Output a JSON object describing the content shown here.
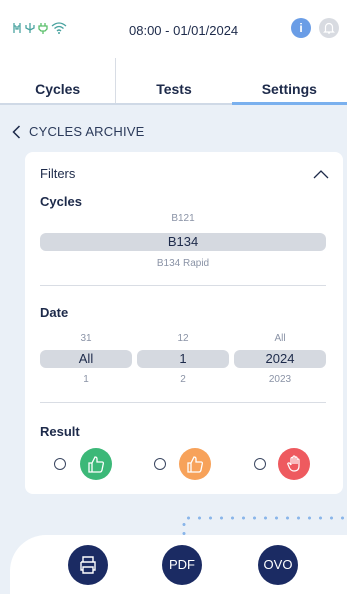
{
  "status": {
    "icons": [
      "antenna-icon",
      "usb-icon",
      "battery-plug-icon",
      "wifi-icon"
    ],
    "clock": "08:00 - 01/01/2024",
    "info_label": "i"
  },
  "tabs": [
    {
      "label": "Cycles",
      "active": false
    },
    {
      "label": "Tests",
      "active": false
    },
    {
      "label": "Settings",
      "active": true
    }
  ],
  "breadcrumb": {
    "label": "CYCLES ARCHIVE"
  },
  "filters": {
    "title": "Filters",
    "cycles": {
      "label": "Cycles",
      "above": "B121",
      "selected": "B134",
      "below": "B134 Rapid"
    },
    "date": {
      "label": "Date",
      "day": {
        "above": "31",
        "selected": "All",
        "below": "1"
      },
      "month": {
        "above": "12",
        "selected": "1",
        "below": "2"
      },
      "year": {
        "above": "All",
        "selected": "2024",
        "below": "2023"
      }
    },
    "result": {
      "label": "Result",
      "options": [
        {
          "name": "pass",
          "color": "#3cb878"
        },
        {
          "name": "warning",
          "color": "#f7a25a"
        },
        {
          "name": "fail",
          "color": "#ee5a5f"
        }
      ]
    }
  },
  "actions": {
    "print_icon": "printer-icon",
    "pdf_label": "PDF",
    "ovo_label": "OVO"
  },
  "colors": {
    "navy": "#1b2b63",
    "accent": "#7ab0ee",
    "background": "#eaf0f7"
  }
}
